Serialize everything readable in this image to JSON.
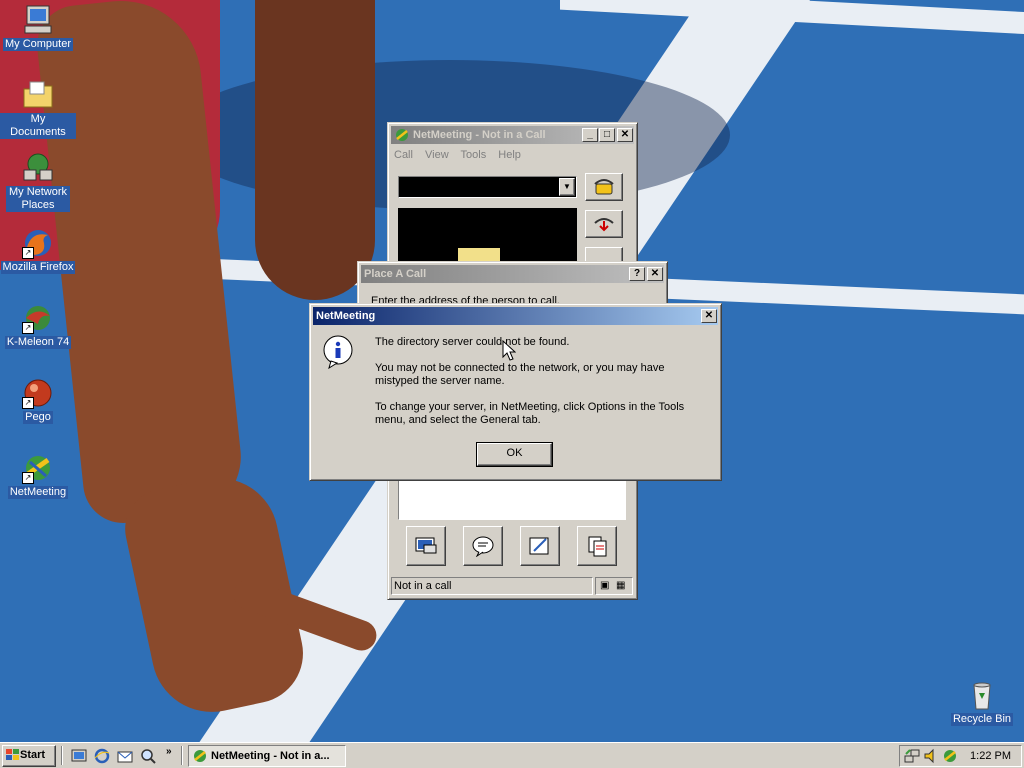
{
  "desktop": {
    "icons": [
      {
        "label": "My Computer",
        "icon": "my-computer-icon"
      },
      {
        "label": "My Documents",
        "icon": "folder-documents-icon"
      },
      {
        "label": "My Network Places",
        "icon": "network-places-icon"
      },
      {
        "label": "Mozilla Firefox",
        "icon": "firefox-icon"
      },
      {
        "label": "K-Meleon 74",
        "icon": "kmeleon-icon"
      },
      {
        "label": "Pego",
        "icon": "pego-icon"
      },
      {
        "label": "NetMeeting",
        "icon": "netmeeting-icon"
      },
      {
        "label": "Recycle Bin",
        "icon": "recycle-bin-icon"
      }
    ]
  },
  "netmeeting_window": {
    "title": "NetMeeting - Not in a Call",
    "menu": [
      "Call",
      "View",
      "Tools",
      "Help"
    ],
    "status": "Not in a call"
  },
  "place_call_dialog": {
    "title": "Place A Call",
    "instruction": "Enter the address of the person to call."
  },
  "message_dialog": {
    "title": "NetMeeting",
    "line1": "The directory server could not be found.",
    "line2": "You may not be connected to the network, or you may have mistyped the server name.",
    "line3": "To change your server, in NetMeeting, click Options in the Tools menu, and select the General tab.",
    "ok_label": "OK"
  },
  "taskbar": {
    "start_label": "Start",
    "task_label": "NetMeeting - Not in a...",
    "clock": "1:22 PM"
  }
}
